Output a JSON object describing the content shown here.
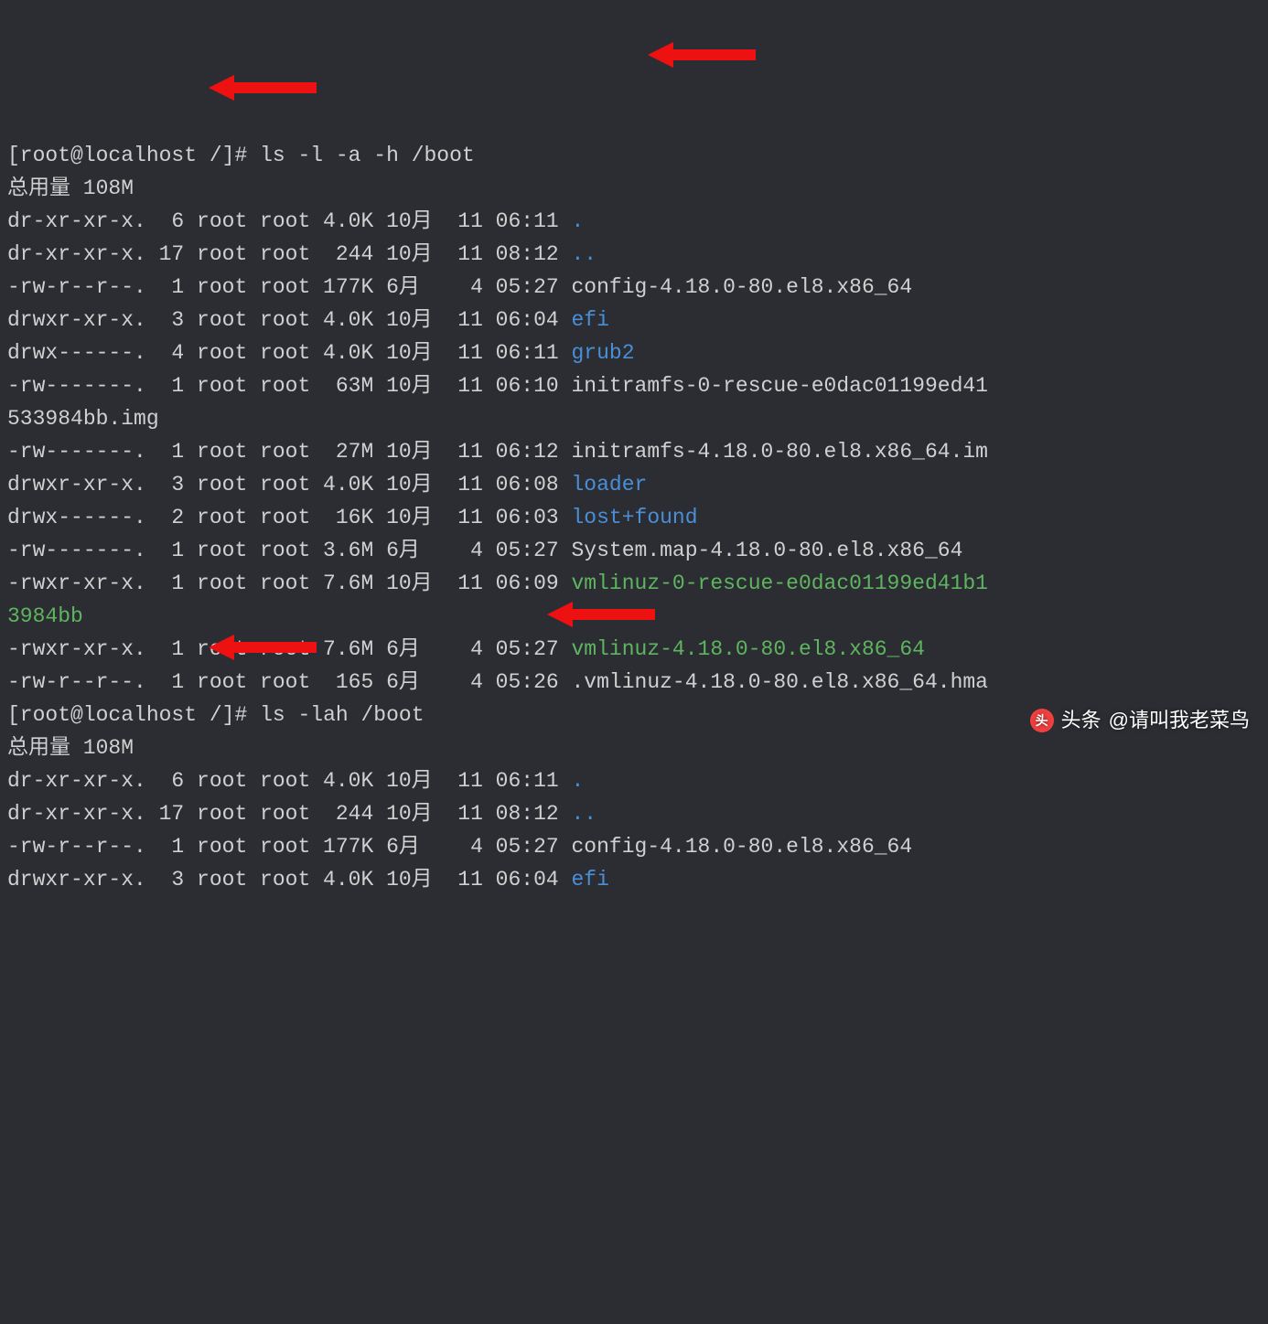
{
  "prompt1": {
    "user_host": "[root@localhost /]#",
    "command": "ls -l -a -h /boot"
  },
  "total1": "总用量 108M",
  "listing1": [
    {
      "perm": "dr-xr-xr-x.",
      "lnk": " 6",
      "own": "root",
      "grp": "root",
      "size": "4.0K",
      "mon": "10月",
      "day": " 11",
      "time": "06:11",
      "name": ".",
      "cls": "dir"
    },
    {
      "perm": "dr-xr-xr-x.",
      "lnk": "17",
      "own": "root",
      "grp": "root",
      "size": " 244",
      "mon": "10月",
      "day": " 11",
      "time": "08:12",
      "name": "..",
      "cls": "dir"
    },
    {
      "perm": "-rw-r--r--.",
      "lnk": " 1",
      "own": "root",
      "grp": "root",
      "size": "177K",
      "mon": "6月 ",
      "day": "  4",
      "time": "05:27",
      "name": "config-4.18.0-80.el8.x86_64",
      "cls": "plain"
    },
    {
      "perm": "drwxr-xr-x.",
      "lnk": " 3",
      "own": "root",
      "grp": "root",
      "size": "4.0K",
      "mon": "10月",
      "day": " 11",
      "time": "06:04",
      "name": "efi",
      "cls": "dir"
    },
    {
      "perm": "drwx------.",
      "lnk": " 4",
      "own": "root",
      "grp": "root",
      "size": "4.0K",
      "mon": "10月",
      "day": " 11",
      "time": "06:11",
      "name": "grub2",
      "cls": "dir"
    },
    {
      "perm": "-rw-------.",
      "lnk": " 1",
      "own": "root",
      "grp": "root",
      "size": " 63M",
      "mon": "10月",
      "day": " 11",
      "time": "06:10",
      "name": "initramfs-0-rescue-e0dac01199ed41",
      "cls": "plain",
      "wrap": "533984bb.img"
    },
    {
      "perm": "-rw-------.",
      "lnk": " 1",
      "own": "root",
      "grp": "root",
      "size": " 27M",
      "mon": "10月",
      "day": " 11",
      "time": "06:12",
      "name": "initramfs-4.18.0-80.el8.x86_64.im",
      "cls": "plain"
    },
    {
      "perm": "drwxr-xr-x.",
      "lnk": " 3",
      "own": "root",
      "grp": "root",
      "size": "4.0K",
      "mon": "10月",
      "day": " 11",
      "time": "06:08",
      "name": "loader",
      "cls": "dir"
    },
    {
      "perm": "drwx------.",
      "lnk": " 2",
      "own": "root",
      "grp": "root",
      "size": " 16K",
      "mon": "10月",
      "day": " 11",
      "time": "06:03",
      "name": "lost+found",
      "cls": "dir"
    },
    {
      "perm": "-rw-------.",
      "lnk": " 1",
      "own": "root",
      "grp": "root",
      "size": "3.6M",
      "mon": "6月 ",
      "day": "  4",
      "time": "05:27",
      "name": "System.map-4.18.0-80.el8.x86_64",
      "cls": "plain"
    },
    {
      "perm": "-rwxr-xr-x.",
      "lnk": " 1",
      "own": "root",
      "grp": "root",
      "size": "7.6M",
      "mon": "10月",
      "day": " 11",
      "time": "06:09",
      "name": "vmlinuz-0-rescue-e0dac01199ed41b1",
      "cls": "exec",
      "wrap": "3984bb",
      "wrapcls": "exec"
    },
    {
      "perm": "-rwxr-xr-x.",
      "lnk": " 1",
      "own": "root",
      "grp": "root",
      "size": "7.6M",
      "mon": "6月 ",
      "day": "  4",
      "time": "05:27",
      "name": "vmlinuz-4.18.0-80.el8.x86_64",
      "cls": "exec"
    },
    {
      "perm": "-rw-r--r--.",
      "lnk": " 1",
      "own": "root",
      "grp": "root",
      "size": " 165",
      "mon": "6月 ",
      "day": "  4",
      "time": "05:26",
      "name": ".vmlinuz-4.18.0-80.el8.x86_64.hma",
      "cls": "plain"
    }
  ],
  "prompt2": {
    "user_host": "[root@localhost /]#",
    "command": "ls -lah /boot"
  },
  "total2": "总用量 108M",
  "listing2": [
    {
      "perm": "dr-xr-xr-x.",
      "lnk": " 6",
      "own": "root",
      "grp": "root",
      "size": "4.0K",
      "mon": "10月",
      "day": " 11",
      "time": "06:11",
      "name": ".",
      "cls": "dir"
    },
    {
      "perm": "dr-xr-xr-x.",
      "lnk": "17",
      "own": "root",
      "grp": "root",
      "size": " 244",
      "mon": "10月",
      "day": " 11",
      "time": "08:12",
      "name": "..",
      "cls": "dir"
    },
    {
      "perm": "-rw-r--r--.",
      "lnk": " 1",
      "own": "root",
      "grp": "root",
      "size": "177K",
      "mon": "6月 ",
      "day": "  4",
      "time": "05:27",
      "name": "config-4.18.0-80.el8.x86_64",
      "cls": "plain"
    },
    {
      "perm": "drwxr-xr-x.",
      "lnk": " 3",
      "own": "root",
      "grp": "root",
      "size": "4.0K",
      "mon": "10月",
      "day": " 11",
      "time": "06:04",
      "name": "efi",
      "cls": "dir"
    }
  ],
  "watermark": {
    "brand": "头条",
    "author": "@请叫我老菜鸟"
  }
}
